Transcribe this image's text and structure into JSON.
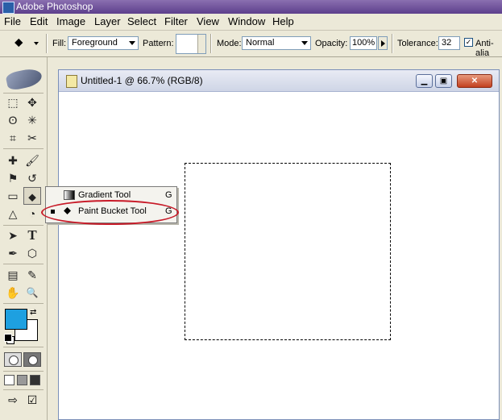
{
  "app": {
    "title": "Adobe Photoshop"
  },
  "menu": [
    "File",
    "Edit",
    "Image",
    "Layer",
    "Select",
    "Filter",
    "View",
    "Window",
    "Help"
  ],
  "options": {
    "fill_label": "Fill:",
    "fill_value": "Foreground",
    "pattern_label": "Pattern:",
    "mode_label": "Mode:",
    "mode_value": "Normal",
    "opacity_label": "Opacity:",
    "opacity_value": "100%",
    "tolerance_label": "Tolerance:",
    "tolerance_value": "32",
    "antialias_label": "Anti-alia"
  },
  "document": {
    "title": "Untitled-1 @ 66.7% (RGB/8)",
    "minimize": "▁",
    "restore": "▣",
    "close": "✕"
  },
  "flyout": {
    "items": [
      {
        "label": "Gradient Tool",
        "key": "G"
      },
      {
        "label": "Paint Bucket Tool",
        "key": "G"
      }
    ]
  },
  "toolbox": {
    "glyphs": {
      "marquee": "⬚",
      "move": "✥",
      "lasso": "ʘ",
      "wand": "✳",
      "crop": "⌗",
      "slice": "✂",
      "heal": "✚",
      "brush": "🖌",
      "stamp": "⚑",
      "history": "↺",
      "eraser": "▭",
      "bucket": "⬥",
      "blur": "△",
      "dodge": "◔",
      "path": "➤",
      "type": "T",
      "pen": "✒",
      "shape": "⬡",
      "notes": "▤",
      "eyedropper": "✎",
      "hand": "✋",
      "zoom": "🔍"
    }
  },
  "colors": {
    "foreground": "#1ea0e0",
    "background": "#ffffff",
    "highlight": "#c81a28"
  }
}
